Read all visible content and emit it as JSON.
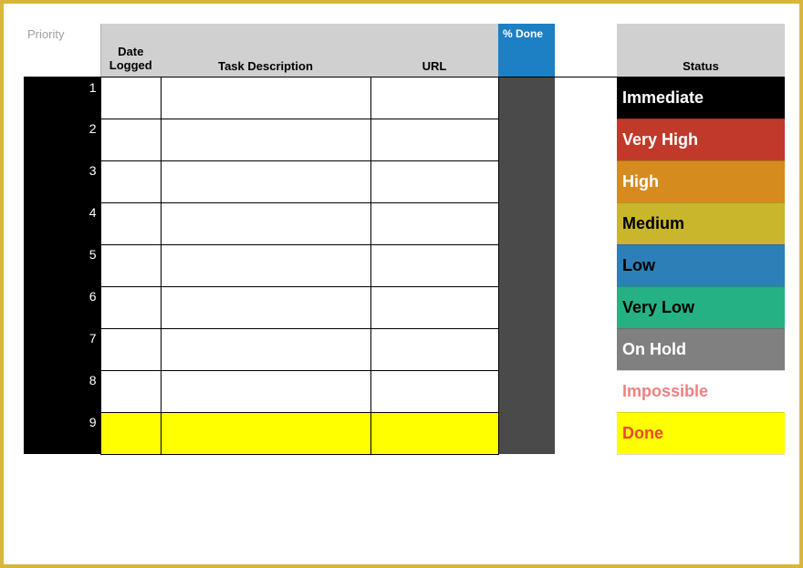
{
  "headers": {
    "priority": "Priority",
    "date_logged": "Date Logged",
    "task_description": "Task Description",
    "url": "URL",
    "percent_done": "% Done",
    "status": "Status"
  },
  "rows": [
    {
      "n": "1",
      "status": "Immediate",
      "status_class": "stat-immediate",
      "highlight": false
    },
    {
      "n": "2",
      "status": "Very High",
      "status_class": "stat-veryhigh",
      "highlight": false
    },
    {
      "n": "3",
      "status": "High",
      "status_class": "stat-high",
      "highlight": false
    },
    {
      "n": "4",
      "status": "Medium",
      "status_class": "stat-medium",
      "highlight": false
    },
    {
      "n": "5",
      "status": "Low",
      "status_class": "stat-low",
      "highlight": false
    },
    {
      "n": "6",
      "status": "Very Low",
      "status_class": "stat-verylow",
      "highlight": false
    },
    {
      "n": "7",
      "status": "On Hold",
      "status_class": "stat-onhold",
      "highlight": false
    },
    {
      "n": "8",
      "status": "Impossible",
      "status_class": "stat-impossible",
      "highlight": false
    },
    {
      "n": "9",
      "status": "Done",
      "status_class": "stat-done",
      "highlight": true
    }
  ]
}
